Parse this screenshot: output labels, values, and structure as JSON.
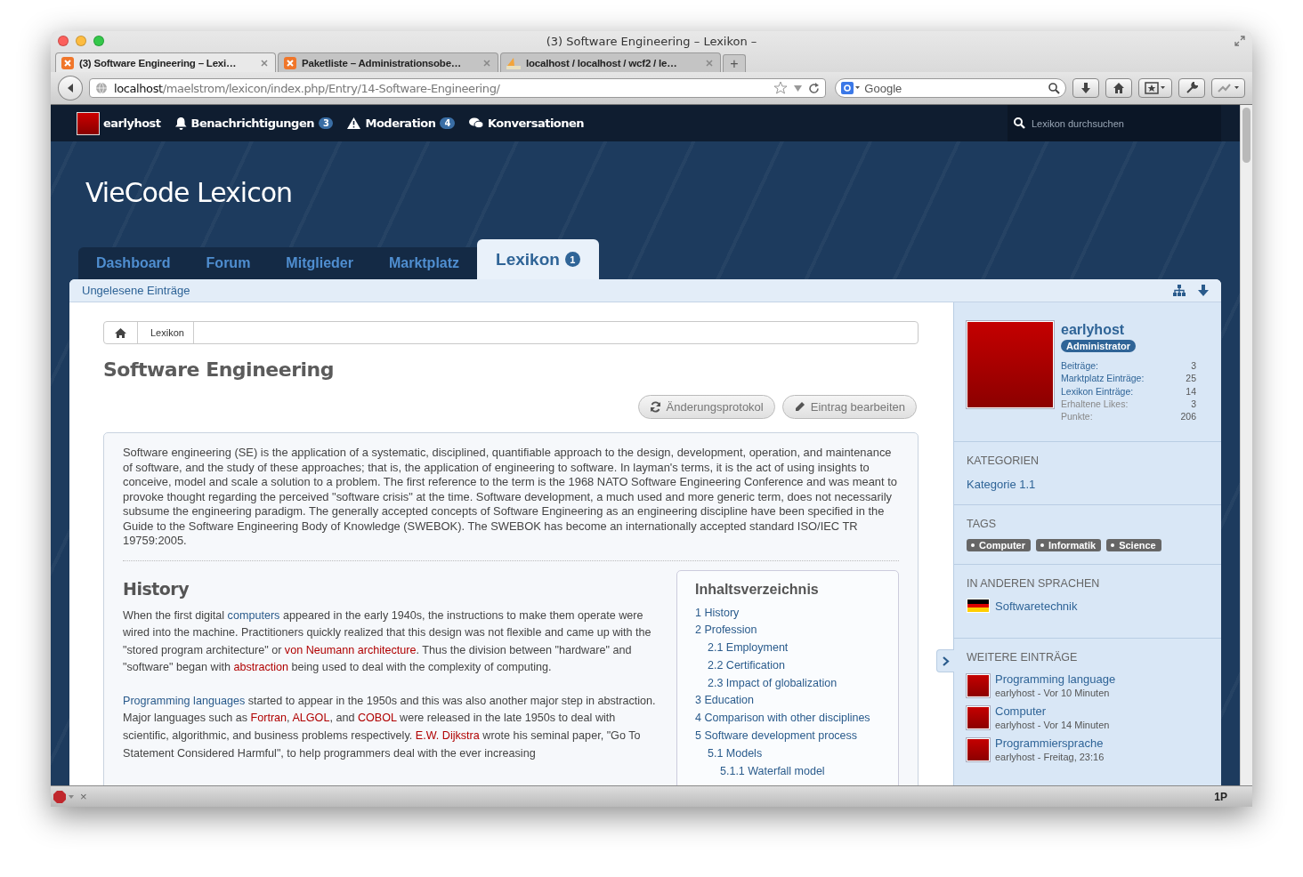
{
  "browser": {
    "window_title": "(3) Software Engineering – Lexikon –",
    "tabs": [
      {
        "title": "(3) Software Engineering – Lexi…",
        "kind": "app",
        "selected": true
      },
      {
        "title": "Paketliste – Administrationsobe…",
        "kind": "app",
        "selected": false
      },
      {
        "title": "localhost / localhost / wcf2 / le…",
        "kind": "database",
        "selected": false
      }
    ],
    "new_tab": "+",
    "url_host": "localhost",
    "url_path": "/maelstrom/lexicon/index.php/Entry/14-Software-Engineering/",
    "search_placeholder": "Google",
    "status_bar": {
      "close": "×",
      "right": "1P"
    }
  },
  "site": {
    "user": "earlyhost",
    "nav": [
      {
        "label": "Benachrichtigungen",
        "kind": "bell",
        "badge": "3"
      },
      {
        "label": "Moderation",
        "kind": "warning",
        "badge": "4"
      },
      {
        "label": "Konversationen",
        "kind": "chat"
      }
    ],
    "search_placeholder": "Lexikon durchsuchen",
    "title": "VieCode Lexicon",
    "tabs": [
      {
        "label": "Dashboard",
        "selected": false
      },
      {
        "label": "Forum",
        "selected": false
      },
      {
        "label": "Mitglieder",
        "selected": false
      },
      {
        "label": "Marktplatz",
        "selected": false
      },
      {
        "label": "Lexikon",
        "badge": "1",
        "selected": true
      }
    ],
    "submenu": [
      "Ungelesene Einträge"
    ],
    "breadcrumb": [
      "Lexikon"
    ],
    "page_title": "Software Engineering",
    "buttons": [
      {
        "label": "Änderungsprotokol",
        "kind": "refresh"
      },
      {
        "label": "Eintrag bearbeiten",
        "kind": "edit"
      }
    ],
    "intro": "Software engineering (SE) is the application of a systematic, disciplined, quantifiable approach to the design, development, operation, and maintenance of software, and the study of these approaches; that is, the application of engineering to software. In layman's terms, it is the act of using insights to conceive, model and scale a solution to a problem. The first reference to the term is the 1968 NATO Software Engineering Conference and was meant to provoke thought regarding the perceived \"software crisis\" at the time. Software development, a much used and more generic term, does not necessarily subsume the engineering paradigm. The generally accepted concepts of Software Engineering as an engineering discipline have been specified in the Guide to the Software Engineering Body of Knowledge (SWEBOK). The SWEBOK has become an internationally accepted standard ISO/IEC TR 19759:2005.",
    "section_heading": "History",
    "paragraphs": [
      [
        {
          "kind": "text",
          "text": "When the first digital "
        },
        {
          "kind": "link",
          "text": "computers"
        },
        {
          "kind": "text",
          "text": " appeared in the early 1940s, the instructions to make them operate were wired into the machine. Practitioners quickly realized that this design was not flexible and came up with the \"stored program architecture\" or "
        },
        {
          "kind": "missing",
          "text": "von Neumann architecture"
        },
        {
          "kind": "text",
          "text": ". Thus the division between \"hardware\" and \"software\" began with "
        },
        {
          "kind": "missing",
          "text": "abstraction"
        },
        {
          "kind": "text",
          "text": " being used to deal with the complexity of computing."
        }
      ],
      [
        {
          "kind": "link",
          "text": "Programming languages"
        },
        {
          "kind": "text",
          "text": " started to appear in the 1950s and this was also another major step in abstraction. Major languages such as "
        },
        {
          "kind": "missing",
          "text": "Fortran"
        },
        {
          "kind": "text",
          "text": ", "
        },
        {
          "kind": "missing",
          "text": "ALGOL"
        },
        {
          "kind": "text",
          "text": ", and "
        },
        {
          "kind": "missing",
          "text": "COBOL"
        },
        {
          "kind": "text",
          "text": " were released in the late 1950s to deal with scientific, algorithmic, and business problems respectively. "
        },
        {
          "kind": "missing",
          "text": "E.W. Dijkstra"
        },
        {
          "kind": "text",
          "text": " wrote his seminal paper, \"Go To Statement Considered Harmful\", to help programmers deal with the ever increasing"
        }
      ]
    ],
    "toc": {
      "title": "Inhaltsverzeichnis",
      "items": [
        {
          "label": "1 History"
        },
        {
          "label": "2 Profession",
          "children": [
            {
              "label": "2.1 Employment"
            },
            {
              "label": "2.2 Certification"
            },
            {
              "label": "2.3 Impact of globalization"
            }
          ]
        },
        {
          "label": "3 Education"
        },
        {
          "label": "4 Comparison with other disciplines"
        },
        {
          "label": "5 Software development process",
          "children": [
            {
              "label": "5.1 Models",
              "children": [
                {
                  "label": "5.1.1 Waterfall model"
                }
              ]
            }
          ]
        }
      ]
    },
    "sidebar": {
      "username": "earlyhost",
      "rank": "Administrator",
      "stats": [
        {
          "label": "Beiträge:",
          "value": "3",
          "kind": "link"
        },
        {
          "label": "Marktplatz Einträge:",
          "value": "25",
          "kind": "link"
        },
        {
          "label": "Lexikon Einträge:",
          "value": "14",
          "kind": "link"
        },
        {
          "label": "Erhaltene Likes:",
          "value": "3",
          "kind": "text"
        },
        {
          "label": "Punkte:",
          "value": "206",
          "kind": "text"
        }
      ],
      "categories_heading": "KATEGORIEN",
      "categories": [
        "Kategorie 1.1"
      ],
      "tags_heading": "TAGS",
      "tags": [
        "Computer",
        "Informatik",
        "Science"
      ],
      "languages_heading": "IN ANDEREN SPRACHEN",
      "languages": [
        "Softwaretechnik"
      ],
      "more_heading": "WEITERE EINTRÄGE",
      "more": [
        {
          "title": "Programming language",
          "meta": "earlyhost - Vor 10 Minuten"
        },
        {
          "title": "Computer",
          "meta": "earlyhost - Vor 14 Minuten"
        },
        {
          "title": "Programmiersprache",
          "meta": "earlyhost - Freitag, 23:16"
        }
      ]
    }
  }
}
